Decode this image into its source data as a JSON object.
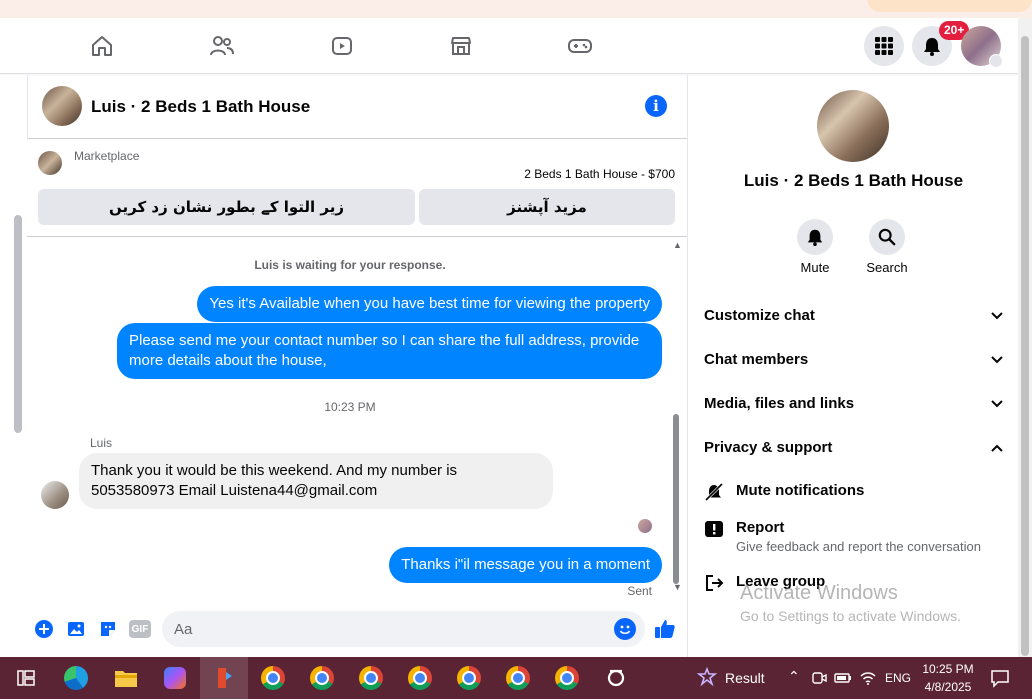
{
  "topnav": {
    "items": [
      "home-icon",
      "friends-icon",
      "video-icon",
      "marketplace-icon",
      "gaming-icon"
    ],
    "notification_count": "20+"
  },
  "chat": {
    "title": "Luis · 2 Beds 1 Bath House",
    "marketplace_label": "Marketplace",
    "listing": "2 Beds 1 Bath House - $700",
    "mark_as_sold_button": "زیر التوا کے بطور نشان زد کریں",
    "more_options_button": "مزید آپشنز",
    "messages": {
      "waiting": "Luis is waiting for your response.",
      "out_1": "Yes it's Available when you have best time for viewing the property",
      "out_2": "Please send me your contact number so I can share the full address, provide more details about the house,",
      "timestamp": "10:23 PM",
      "sender": "Luis",
      "in_1": "Thank you it would be this weekend. And my number is 5053580973 Email Luistena44@gmail.com",
      "out_3": "Thanks i\"il message you in a moment",
      "status": "Sent"
    },
    "composer": {
      "placeholder": "Aa",
      "gif_label": "GIF"
    }
  },
  "details": {
    "title": "Luis · 2 Beds 1 Bath House",
    "mute_label": "Mute",
    "search_label": "Search",
    "sections": [
      "Customize chat",
      "Chat members",
      "Media, files and links",
      "Privacy & support"
    ],
    "privacy": {
      "mute_notifications": "Mute notifications",
      "report": "Report",
      "report_desc": "Give feedback and report the conversation",
      "leave_group": "Leave group"
    },
    "watermark_title": "Activate Windows",
    "watermark_sub": "Go to Settings to activate Windows."
  },
  "taskbar": {
    "result_label": "Result",
    "language": "ENG",
    "time": "10:25 PM",
    "date": "4/8/2025"
  },
  "colors": {
    "accent": "#0866ff",
    "bubble_out": "#0084ff",
    "taskbar": "#5a2434"
  }
}
